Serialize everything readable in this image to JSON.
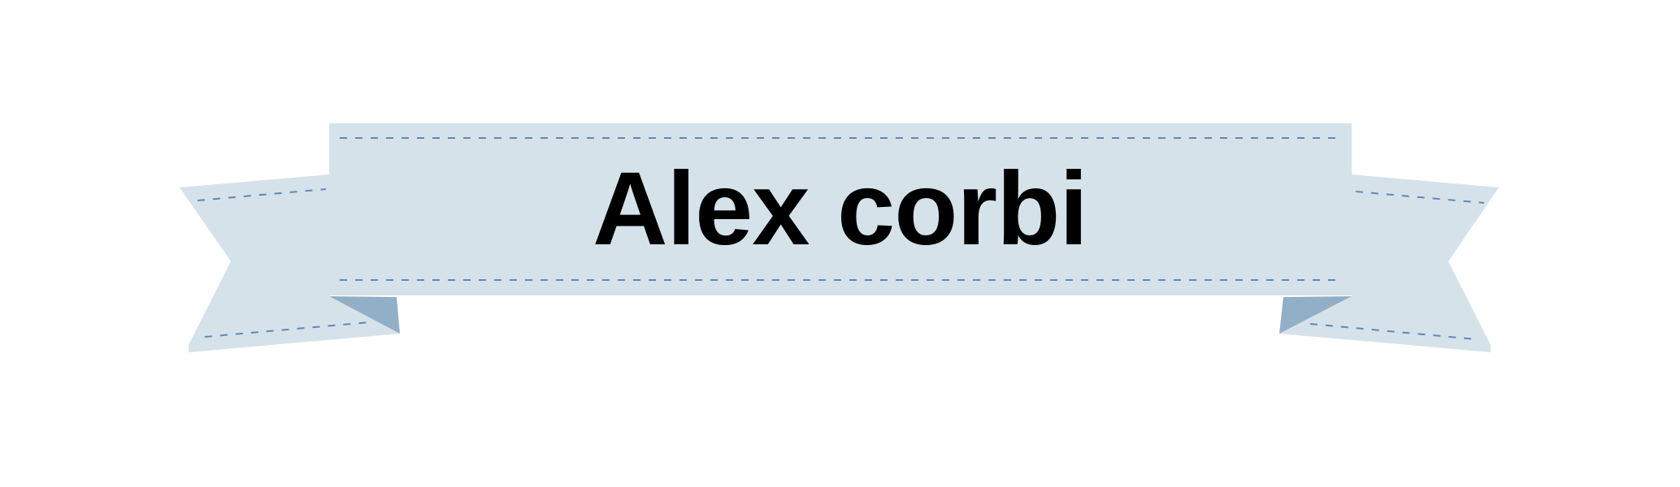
{
  "banner": {
    "title": "Alex corbi"
  },
  "colors": {
    "ribbon_fill": "#d6e2ea",
    "ribbon_fold": "#91afc6",
    "stitch": "#5b8bb5",
    "text": "#000000",
    "background": "#ffffff"
  }
}
